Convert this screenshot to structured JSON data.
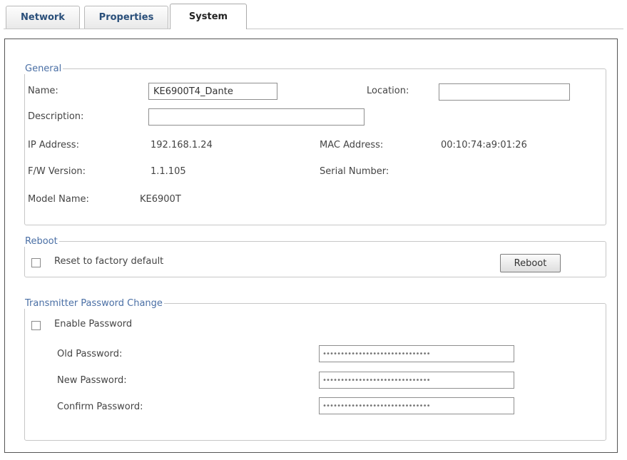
{
  "tabs": [
    {
      "label": "Network",
      "active": false
    },
    {
      "label": "Properties",
      "active": false
    },
    {
      "label": "System",
      "active": true
    }
  ],
  "general": {
    "legend": "General",
    "name_label": "Name:",
    "name_value": "KE6900T4_Dante",
    "location_label": "Location:",
    "location_value": "",
    "description_label": "Description:",
    "description_value": "",
    "ip_label": "IP Address:",
    "ip_value": "192.168.1.24",
    "mac_label": "MAC Address:",
    "mac_value": "00:10:74:a9:01:26",
    "fw_label": "F/W Version:",
    "fw_value": "1.1.105",
    "serial_label": "Serial Number:",
    "serial_value": "",
    "model_label": "Model Name:",
    "model_value": "KE6900T"
  },
  "reboot": {
    "legend": "Reboot",
    "reset_label": "Reset to factory default",
    "reset_checked": false,
    "button_label": "Reboot"
  },
  "password": {
    "legend": "Transmitter Password Change",
    "enable_label": "Enable Password",
    "enable_checked": false,
    "old_label": "Old Password:",
    "old_value": "••••••••••••••••••••••••••••••",
    "new_label": "New Password:",
    "new_value": "••••••••••••••••••••••••••••••",
    "confirm_label": "Confirm Password:",
    "confirm_value": "••••••••••••••••••••••••••••••"
  }
}
